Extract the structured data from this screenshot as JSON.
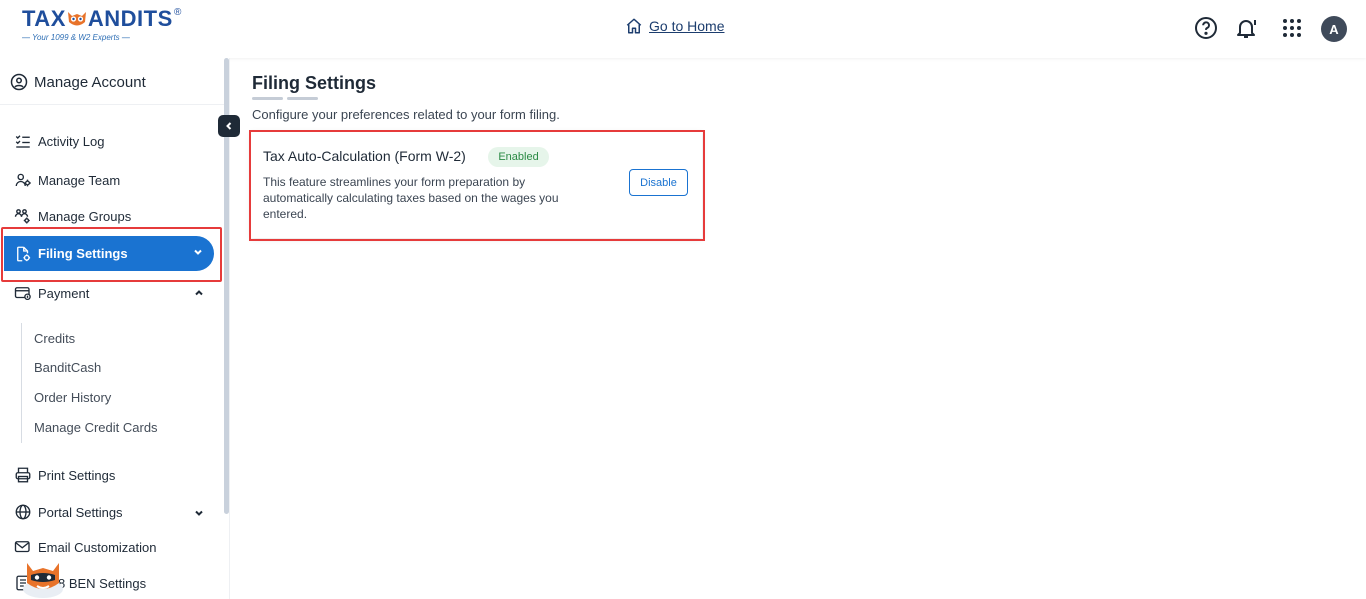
{
  "header": {
    "logo_text": "TAXBANDITS",
    "logo_reg": "®",
    "logo_tagline": "Your 1099 & W2 Experts",
    "home_link": "Go to Home",
    "avatar_initial": "A",
    "icons": [
      "help-icon",
      "bell-icon",
      "apps-grid-icon"
    ]
  },
  "sidebar": {
    "heading": "Manage Account",
    "items": [
      {
        "label": "Activity Log",
        "icon": "checklist-icon"
      },
      {
        "label": "Manage Team",
        "icon": "team-icon"
      },
      {
        "label": "Manage Groups",
        "icon": "groups-icon"
      },
      {
        "label": "Filing Settings",
        "icon": "document-settings-icon",
        "active": true
      },
      {
        "label": "Payment",
        "icon": "payment-icon",
        "expanded": true
      },
      {
        "label": "Print Settings",
        "icon": "printer-icon"
      },
      {
        "label": "Portal Settings",
        "icon": "globe-icon"
      },
      {
        "label": "Email Customization",
        "icon": "mail-icon"
      },
      {
        "label": "/W-8 BEN Settings",
        "icon": "form-icon"
      }
    ],
    "payment_subitems": [
      "Credits",
      "BanditCash",
      "Order History",
      "Manage Credit Cards"
    ]
  },
  "main": {
    "title": "Filing Settings",
    "subtitle": "Configure your preferences related to your form filing.",
    "card": {
      "title": "Tax Auto-Calculation (Form W-2)",
      "badge": "Enabled",
      "description": "This feature streamlines your form preparation by automatically calculating taxes based on the wages you entered.",
      "button": "Disable"
    }
  },
  "colors": {
    "accent": "#1a73d1",
    "highlight": "#e63b3b",
    "badge_bg": "#e6f5ea",
    "badge_text": "#2a8a44"
  }
}
